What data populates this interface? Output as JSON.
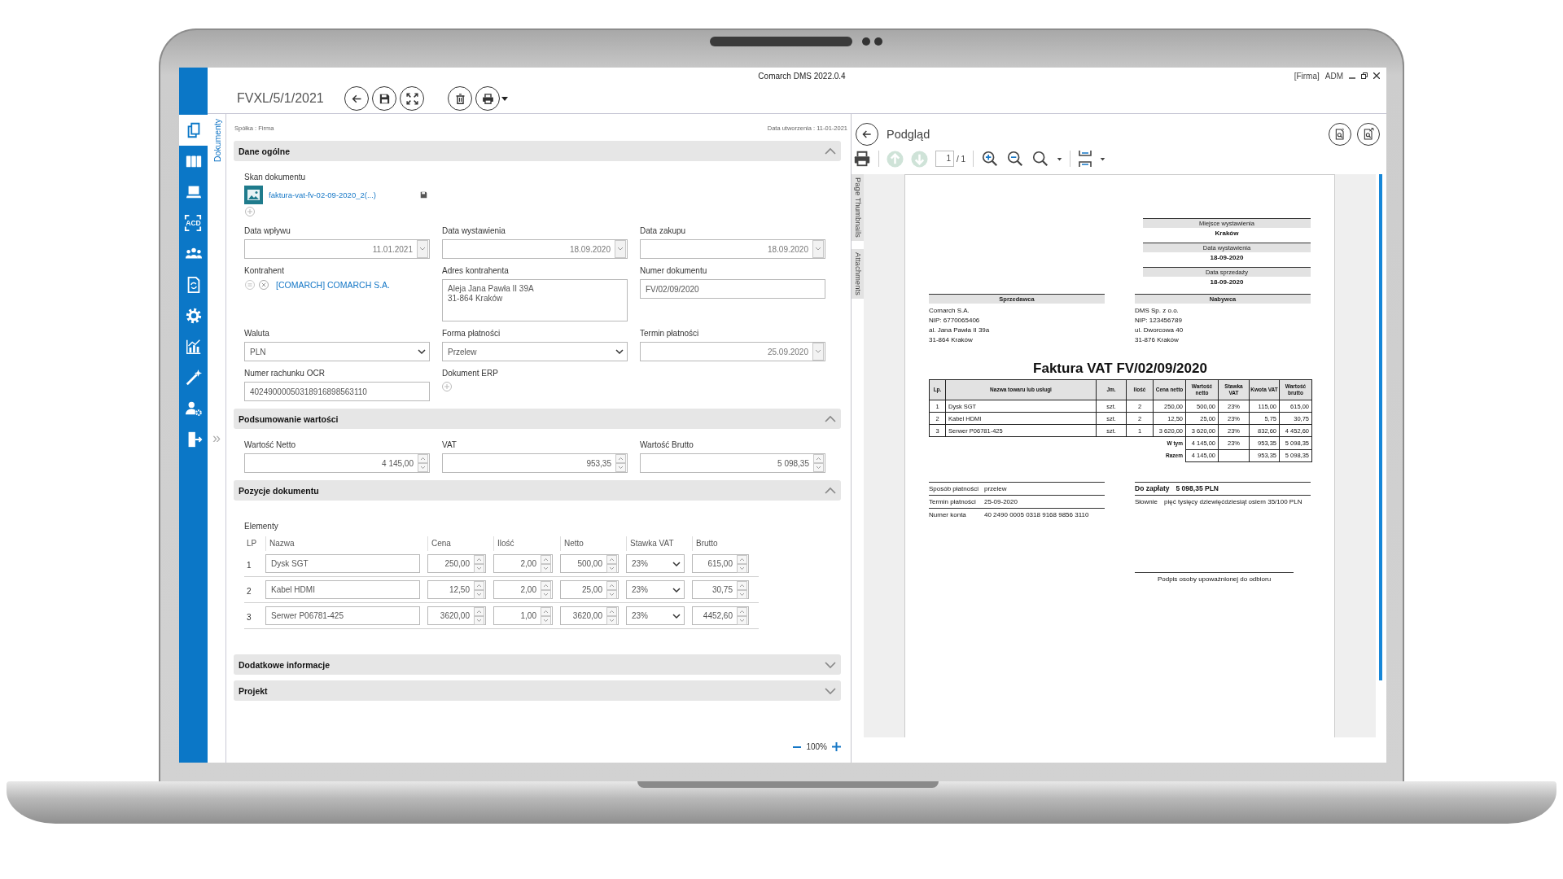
{
  "app": {
    "title": "Comarch DMS 2022.0.4",
    "company": "[Firma]",
    "user": "ADM"
  },
  "sidebar": {
    "items": [
      {
        "kind": "documents",
        "selected": true
      },
      {
        "kind": "binders",
        "selected": false
      },
      {
        "kind": "laptop",
        "selected": false
      },
      {
        "kind": "scan",
        "label": "ACD",
        "selected": false
      },
      {
        "kind": "users",
        "selected": false
      },
      {
        "kind": "refresh-document",
        "selected": false
      },
      {
        "kind": "settings",
        "selected": false
      },
      {
        "kind": "chart",
        "selected": false
      },
      {
        "kind": "wand",
        "selected": false
      },
      {
        "kind": "user-settings",
        "selected": false
      },
      {
        "kind": "exit",
        "selected": false
      }
    ]
  },
  "side_tab": {
    "label": "Dokumenty",
    "expand": "»"
  },
  "toolbar": {
    "document_number": "FVXL/5/1/2021",
    "buttons": [
      {
        "kind": "back"
      },
      {
        "kind": "save"
      },
      {
        "kind": "fullscreen"
      },
      {
        "kind": "delete"
      },
      {
        "kind": "print",
        "dropdown": true
      }
    ]
  },
  "form": {
    "company": "Spółka : Firma",
    "created": "Data utworzenia : 11-01-2021",
    "sections": [
      {
        "kind": "general",
        "title": "Dane ogólne",
        "expanded": true,
        "scan": {
          "label": "Skan dokumentu",
          "file": "faktura-vat-fv-02-09-2020_2(...)"
        },
        "fields": [
          {
            "kind": "date",
            "label": "Data wpływu",
            "value": "11.01.2021"
          },
          {
            "kind": "date",
            "label": "Data wystawienia",
            "value": "18.09.2020"
          },
          {
            "kind": "date",
            "label": "Data zakupu",
            "value": "18.09.2020"
          },
          {
            "kind": "contractor",
            "label": "Kontrahent",
            "value": "[COMARCH] COMARCH S.A."
          },
          {
            "kind": "textarea",
            "label": "Adres kontrahenta",
            "lines": [
              "Aleja Jana Pawła II 39A",
              "31-864 Kraków"
            ]
          },
          {
            "kind": "text",
            "label": "Numer dokumentu",
            "value": "FV/02/09/2020"
          },
          {
            "kind": "select",
            "label": "Waluta",
            "value": "PLN"
          },
          {
            "kind": "select",
            "label": "Forma płatności",
            "value": "Przelew"
          },
          {
            "kind": "date",
            "label": "Termin płatności",
            "value": "25.09.2020"
          },
          {
            "kind": "text",
            "label": "Numer rachunku OCR",
            "value": "40249000050318916898563110"
          },
          {
            "kind": "add",
            "label": "Dokument ERP"
          }
        ]
      },
      {
        "kind": "fields",
        "title": "Podsumowanie wartości",
        "expanded": true,
        "fields": [
          {
            "kind": "number",
            "label": "Wartość Netto",
            "value": "4 145,00"
          },
          {
            "kind": "number",
            "label": "VAT",
            "value": "953,35"
          },
          {
            "kind": "number",
            "label": "Wartość Brutto",
            "value": "5 098,35"
          }
        ]
      },
      {
        "kind": "items",
        "title": "Pozycje dokumentu",
        "expanded": true,
        "caption": "Elementy",
        "columns": [
          "LP",
          "Nazwa",
          "Cena",
          "Ilość",
          "Netto",
          "Stawka VAT",
          "Brutto"
        ],
        "rows": [
          {
            "lp": "1",
            "name": "Dysk SGT",
            "price": "250,00",
            "quantity": "2,00",
            "net": "500,00",
            "vat": "23%",
            "gross": "615,00"
          },
          {
            "lp": "2",
            "name": "Kabel HDMI",
            "price": "12,50",
            "quantity": "2,00",
            "net": "25,00",
            "vat": "23%",
            "gross": "30,75"
          },
          {
            "lp": "3",
            "name": "Serwer P06781-425",
            "price": "3620,00",
            "quantity": "1,00",
            "net": "3620,00",
            "vat": "23%",
            "gross": "4452,60"
          }
        ]
      },
      {
        "title": "Dodatkowe informacje",
        "expanded": false
      },
      {
        "title": "Projekt",
        "expanded": false
      }
    ],
    "zoom": "100%"
  },
  "preview": {
    "title": "Podgląd",
    "page": "1",
    "page_count": "/ 1",
    "side_tabs": [
      "Page Thumbnails",
      "Attachments"
    ],
    "invoice": {
      "header": [
        {
          "label": "Miejsce wystawienia",
          "value": "Kraków"
        },
        {
          "label": "Data wystawienia",
          "value": "18-09-2020"
        },
        {
          "label": "Data sprzedaży",
          "value": "18-09-2020"
        }
      ],
      "parties": [
        {
          "label": "Sprzedawca",
          "lines": [
            "Comarch S.A.",
            "NIP: 6770065406",
            "al. Jana Pawła II 39a",
            "31-864 Kraków"
          ]
        },
        {
          "label": "Nabywca",
          "lines": [
            "DMS Sp. z o.o.",
            "NIP: 123456789",
            "ul. Dworcowa 40",
            "31-876 Kraków"
          ]
        }
      ],
      "title": "Faktura VAT FV/02/09/2020",
      "columns": [
        "Lp.",
        "Nazwa towaru lub usługi",
        "Jm.",
        "Ilość",
        "Cena netto",
        "Wartość netto",
        "Stawka VAT",
        "Kwota VAT",
        "Wartość brutto"
      ],
      "rows": [
        [
          "1",
          "Dysk SGT",
          "szt.",
          "2",
          "250,00",
          "500,00",
          "23%",
          "115,00",
          "615,00"
        ],
        [
          "2",
          "Kabel HDMI",
          "szt.",
          "2",
          "12,50",
          "25,00",
          "23%",
          "5,75",
          "30,75"
        ],
        [
          "3",
          "Serwer P06781-425",
          "szt.",
          "1",
          "3 620,00",
          "3 620,00",
          "23%",
          "832,60",
          "4 452,60"
        ]
      ],
      "totals": [
        {
          "label": "W tym",
          "net": "4 145,00",
          "rate": "23%",
          "vat": "953,35",
          "gross": "5 098,35"
        },
        {
          "label": "Razem",
          "net": "4 145,00",
          "vat": "953,35",
          "gross": "5 098,35"
        }
      ],
      "payment": [
        {
          "label": "Sposób płatności",
          "value": "przelew"
        },
        {
          "label": "Termin płatności",
          "value": "25-09-2020"
        },
        {
          "label": "Numer konta",
          "value": "40 2490 0005 0318 9168 9856 3110"
        }
      ],
      "due": {
        "label": "Do zapłaty",
        "value": "5 098,35 PLN"
      },
      "in_words": {
        "label": "Słownie",
        "value": "pięć tysięcy dziewięćdziesiąt osiem 35/100 PLN"
      },
      "signature": "Podpis osoby upoważnionej do odbioru"
    }
  }
}
